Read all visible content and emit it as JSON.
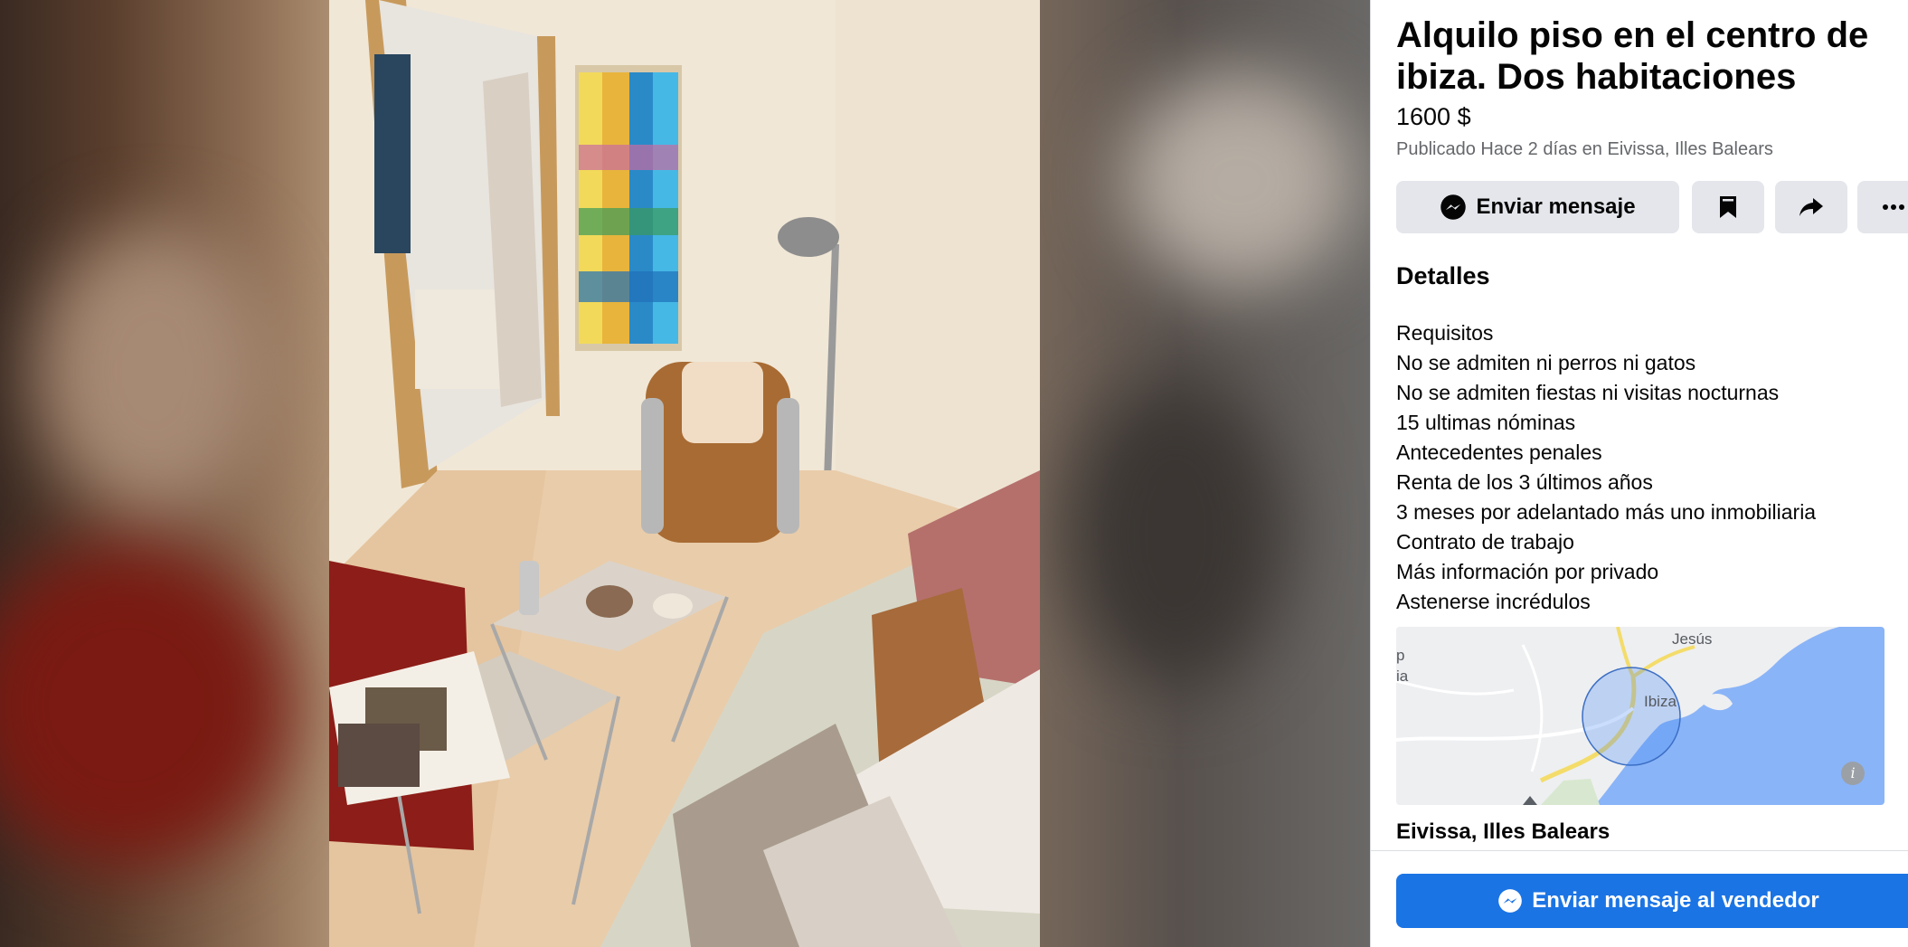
{
  "listing": {
    "title": "Alquilo piso en el centro de ibiza. Dos habitaciones",
    "price": "1600 $",
    "published_prefix": "Publicado Hace 2 días en ",
    "published_location": "Eivissa, Illes Balears"
  },
  "actions": {
    "message_label": "Enviar mensaje",
    "save_icon": "bookmark-icon",
    "share_icon": "share-icon",
    "more_icon": "more-icon"
  },
  "details": {
    "heading": "Detalles",
    "lines": [
      "Requisitos",
      "No se admiten ni perros ni gatos",
      "No se admiten fiestas ni visitas nocturnas",
      "15 ultimas nóminas",
      "Antecedentes penales",
      "Renta de los 3 últimos años",
      "3 meses por adelantado más uno inmobiliaria",
      "Contrato de trabajo",
      "Más información por privado",
      "Astenerse incrédulos"
    ]
  },
  "map": {
    "labels": {
      "town_1": "Jesús",
      "town_2": "Ibiza",
      "edge_1": "p",
      "edge_2": "ia"
    },
    "info_icon": "i",
    "location": "Eivissa, Illes Balears"
  },
  "footer": {
    "seller_button_label": "Enviar mensaje al vendedor"
  },
  "colors": {
    "primary": "#1b74e4",
    "button_gray": "#e4e6eb",
    "secondary_text": "#65676b",
    "map_water": "#8ab4f8"
  }
}
